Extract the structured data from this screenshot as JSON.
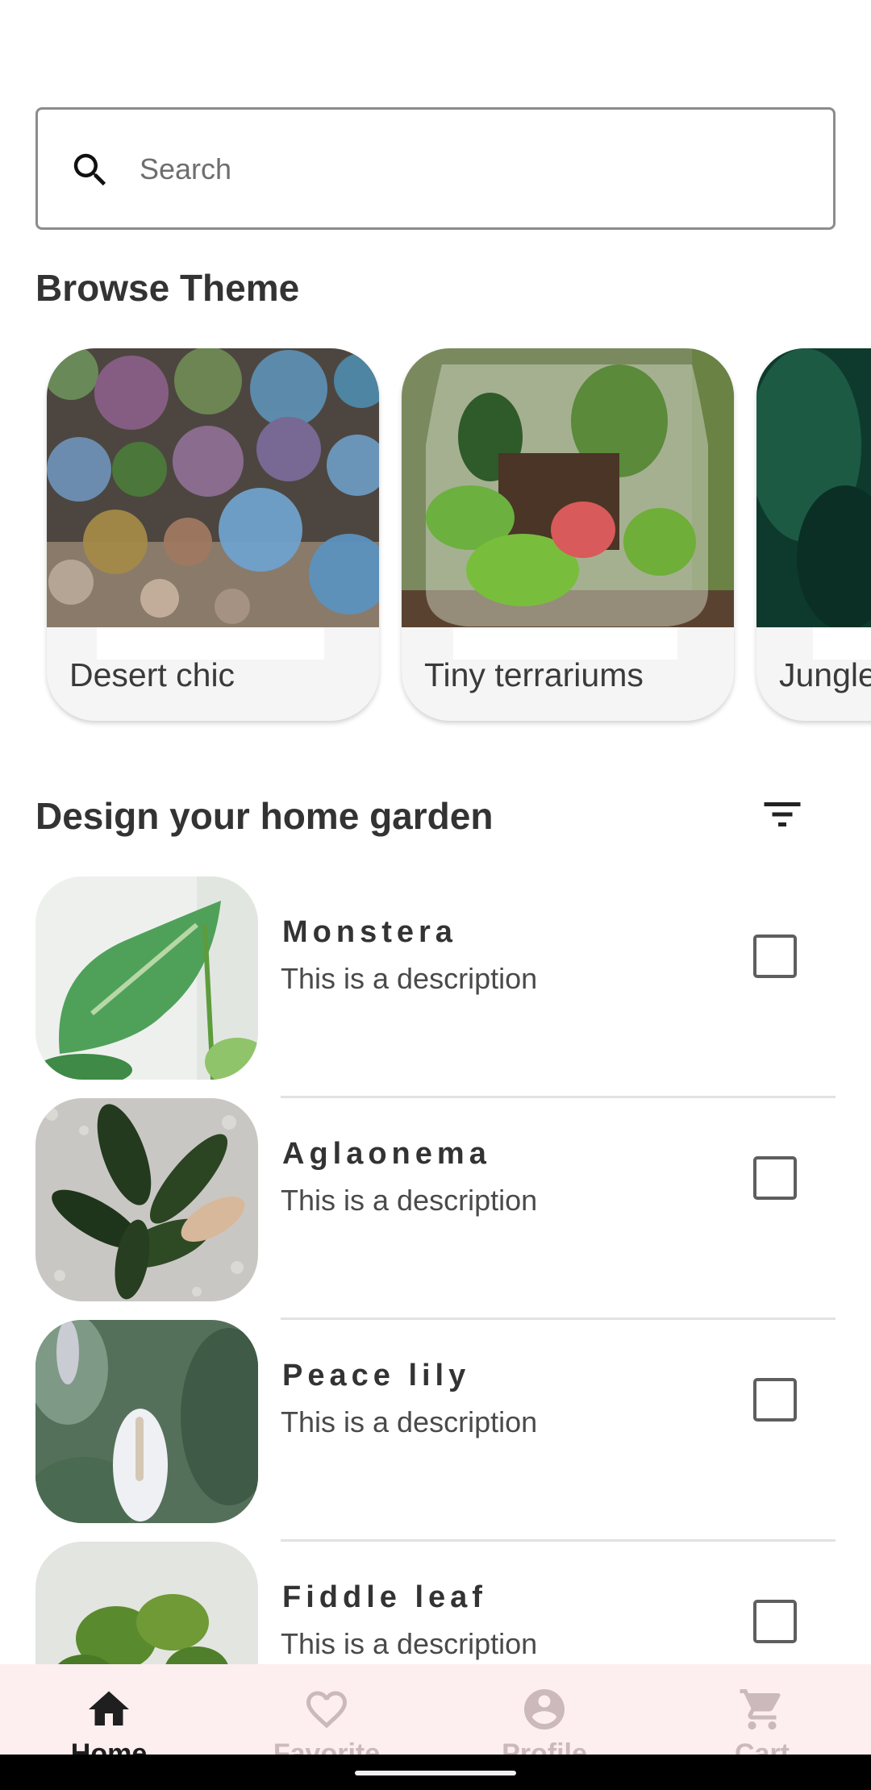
{
  "search": {
    "placeholder": "Search",
    "icon": "search-icon"
  },
  "browse": {
    "title": "Browse Theme",
    "themes": [
      {
        "label": "Desert chic"
      },
      {
        "label": "Tiny terrariums"
      },
      {
        "label": "Jungle"
      }
    ]
  },
  "garden": {
    "title": "Design your home garden",
    "filter_icon": "filter-icon",
    "items": [
      {
        "name": "Monstera",
        "description": "This is a description",
        "checked": false
      },
      {
        "name": "Aglaonema",
        "description": "This is a description",
        "checked": false
      },
      {
        "name": "Peace lily",
        "description": "This is a description",
        "checked": false
      },
      {
        "name": "Fiddle leaf",
        "description": "This is a description",
        "checked": false
      }
    ]
  },
  "bottom_nav": {
    "items": [
      {
        "label": "Home",
        "icon": "home-icon",
        "active": true
      },
      {
        "label": "Favorite",
        "icon": "heart-icon",
        "active": false
      },
      {
        "label": "Profile",
        "icon": "profile-icon",
        "active": false
      },
      {
        "label": "Cart",
        "icon": "cart-icon",
        "active": false
      }
    ]
  },
  "colors": {
    "nav_background": "#fdeff0",
    "text_primary": "#333333",
    "divider": "#e2e2e2"
  }
}
